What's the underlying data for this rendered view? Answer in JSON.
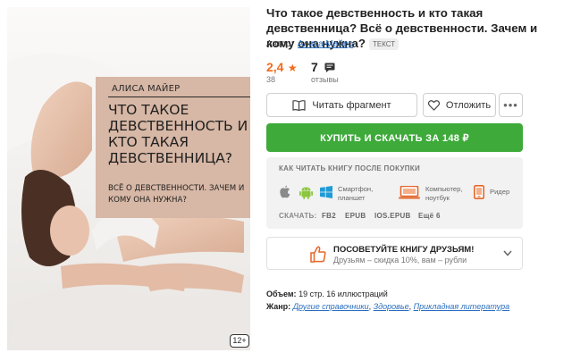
{
  "cover": {
    "author": "АЛИСА МАЙЕР",
    "title": "ЧТО ТАКОЕ ДЕВСТВЕННОСТЬ И КТО ТАКАЯ ДЕВСТВЕННИЦА?",
    "subtitle": "ВСЁ О ДЕВСТВЕННОСТИ. ЗАЧЕМ И КОМУ ОНА НУЖНА?",
    "age": "12+"
  },
  "book": {
    "title": "Что такое девственность и кто такая девственница? Всё о девственности. Зачем и кому она нужна?",
    "tag": "ТЕКСТ",
    "author_label": "Автор:",
    "author_name": "Алиса Майер"
  },
  "rating": {
    "value": "2,4",
    "votes": "38",
    "reviews": "7",
    "reviews_label": "отзывы"
  },
  "actions": {
    "read_fragment": "Читать фрагмент",
    "postpone": "Отложить",
    "more": "•••",
    "buy": "КУПИТЬ И СКАЧАТЬ ЗА 148 ₽"
  },
  "how_to_read": {
    "title": "КАК ЧИТАТЬ КНИГУ ПОСЛЕ ПОКУПКИ",
    "devices": [
      {
        "icon": "smartphone-icon",
        "label": "Смартфон, планшет"
      },
      {
        "icon": "laptop-icon",
        "label": "Компьютер, ноутбук"
      },
      {
        "icon": "reader-icon",
        "label": "Ридер"
      }
    ],
    "download_label": "СКАЧАТЬ:",
    "formats": [
      "FB2",
      "EPUB",
      "IOS.EPUB",
      "Ещё 6"
    ]
  },
  "share": {
    "title": "ПОСОВЕТУЙТЕ КНИГУ ДРУЗЬЯМ!",
    "subtitle": "Друзьям – скидка 10%, вам – рубли"
  },
  "meta": {
    "volume_label": "Объем:",
    "volume_value": "19 стр. 16 иллюстраций",
    "genre_label": "Жанр:",
    "genres": [
      "Другие справочники",
      "Здоровье",
      "Прикладная литература"
    ]
  },
  "colors": {
    "accent_orange": "#f26b1d",
    "buy_green": "#3daa3a",
    "link_blue": "#2a6fbf",
    "cover_panel": "#d7b7a5"
  }
}
